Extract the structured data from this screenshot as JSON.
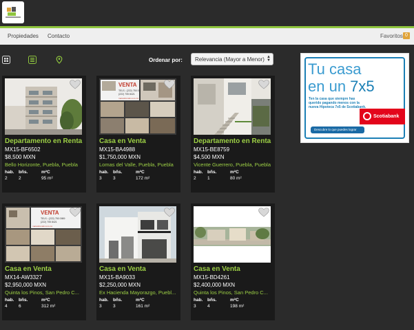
{
  "nav": {
    "items": [
      {
        "label": "Propiedades"
      },
      {
        "label": "Contacto"
      }
    ],
    "favorites_label": "Favoritos",
    "favorites_count": "0"
  },
  "toolbar": {
    "sort_label": "Ordenar por:",
    "sort_value": "Relevancia (Mayor a Menor)",
    "icons": [
      "grid-icon",
      "list-icon",
      "map-pin-icon"
    ]
  },
  "colors": {
    "accent": "#8fc53e",
    "title_green": "#9ccf45",
    "card_bg": "#1a1a1a",
    "page_bg": "#2b2b2b"
  },
  "listings": [
    {
      "title": "Departamento en Renta",
      "code": "MX15-BF6502",
      "price": "$8,500 MXN",
      "location": "Bello Horizonte, Puebla, Puebla",
      "h_hab": "hab.",
      "h_ban": "bñs.",
      "h_m2": "m²C",
      "hab": "2",
      "ban": "2",
      "m2": "95 m²"
    },
    {
      "title": "Casa en Venta",
      "code": "MX15-BA4988",
      "price": "$1,750,000 MXN",
      "location": "Lomas del Valle, Puebla, Puebla",
      "h_hab": "hab.",
      "h_ban": "bñs.",
      "h_m2": "m²C",
      "hab": "3",
      "ban": "3",
      "m2": "172 m²",
      "sign": {
        "title": "VENTA",
        "tel1": "TELS.: (222) 750 0989",
        "tel2": "(222) 705 8421",
        "web": "marsolinmobi.com.mx"
      }
    },
    {
      "title": "Departamento en Renta",
      "code": "MX15-BE8759",
      "price": "$4,500 MXN",
      "location": "Vicente Guerrero, Puebla, Puebla",
      "h_hab": "hab.",
      "h_ban": "bñs.",
      "h_m2": "m²C",
      "hab": "2",
      "ban": "1",
      "m2": "80 m²"
    },
    {
      "title": "Casa en Venta",
      "code": "MX14-AW3327",
      "price": "$2,950,000 MXN",
      "location": "Quinta los Pinos, San Pedro C...",
      "h_hab": "hab.",
      "h_ban": "bñs.",
      "h_m2": "m²C",
      "hab": "4",
      "ban": "6",
      "m2": "312 m²",
      "sign": {
        "title": "VENTA",
        "tel1": "TELS.: (222) 750 0989",
        "tel2": "(222) 705 8421",
        "web": "marsolinmobi.com.mx"
      }
    },
    {
      "title": "Casa en Venta",
      "code": "MX15-BA9033",
      "price": "$2,250,000 MXN",
      "location": "Ex Hacienda Mayorazgo, Puebl...",
      "h_hab": "hab.",
      "h_ban": "bñs.",
      "h_m2": "m²C",
      "hab": "3",
      "ban": "3",
      "m2": "161 m²"
    },
    {
      "title": "Casa en Venta",
      "code": "MX15-BD4261",
      "price": "$2,400,000 MXN",
      "location": "Quinta los Pinos, San Pedro C...",
      "h_hab": "hab.",
      "h_ban": "bñs.",
      "h_m2": "m²C",
      "hab": "3",
      "ban": "4",
      "m2": "198 m²"
    }
  ],
  "ad": {
    "line1": "Tu casa",
    "line2a": "en un ",
    "line2b": "7x5",
    "text": "Ten la casa que siempre has querido pagando menos con la nueva Hipoteca 7x5 de Scotiabank.",
    "brand": "Scotiabank",
    "button": "Descubre lo que puedes lograr"
  }
}
